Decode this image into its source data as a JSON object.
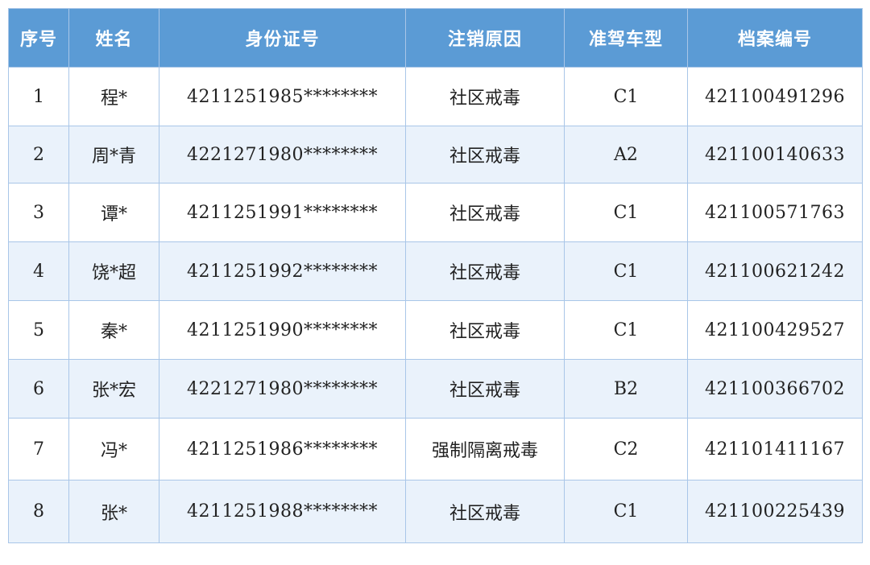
{
  "table": {
    "headers": [
      "序号",
      "姓名",
      "身份证号",
      "注销原因",
      "准驾车型",
      "档案编号"
    ],
    "rows": [
      {
        "no": "1",
        "name": "程*",
        "id_number": "4211251985********",
        "reason": "社区戒毒",
        "license_class": "C1",
        "file_number": "421100491296"
      },
      {
        "no": "2",
        "name": "周*青",
        "id_number": "4221271980********",
        "reason": "社区戒毒",
        "license_class": "A2",
        "file_number": "421100140633"
      },
      {
        "no": "3",
        "name": "谭*",
        "id_number": "4211251991********",
        "reason": "社区戒毒",
        "license_class": "C1",
        "file_number": "421100571763"
      },
      {
        "no": "4",
        "name": "饶*超",
        "id_number": "4211251992********",
        "reason": "社区戒毒",
        "license_class": "C1",
        "file_number": "421100621242"
      },
      {
        "no": "5",
        "name": "秦*",
        "id_number": "4211251990********",
        "reason": "社区戒毒",
        "license_class": "C1",
        "file_number": "421100429527"
      },
      {
        "no": "6",
        "name": "张*宏",
        "id_number": "4221271980********",
        "reason": "社区戒毒",
        "license_class": "B2",
        "file_number": "421100366702"
      },
      {
        "no": "7",
        "name": "冯*",
        "id_number": "4211251986********",
        "reason": "强制隔离戒毒",
        "license_class": "C2",
        "file_number": "421101411167"
      },
      {
        "no": "8",
        "name": "张*",
        "id_number": "4211251988********",
        "reason": "社区戒毒",
        "license_class": "C1",
        "file_number": "421100225439"
      }
    ]
  },
  "colors": {
    "header_bg": "#5b9bd5",
    "header_text": "#ffffff",
    "row_alt_bg": "#eaf2fb",
    "border": "#a9c6e8"
  }
}
